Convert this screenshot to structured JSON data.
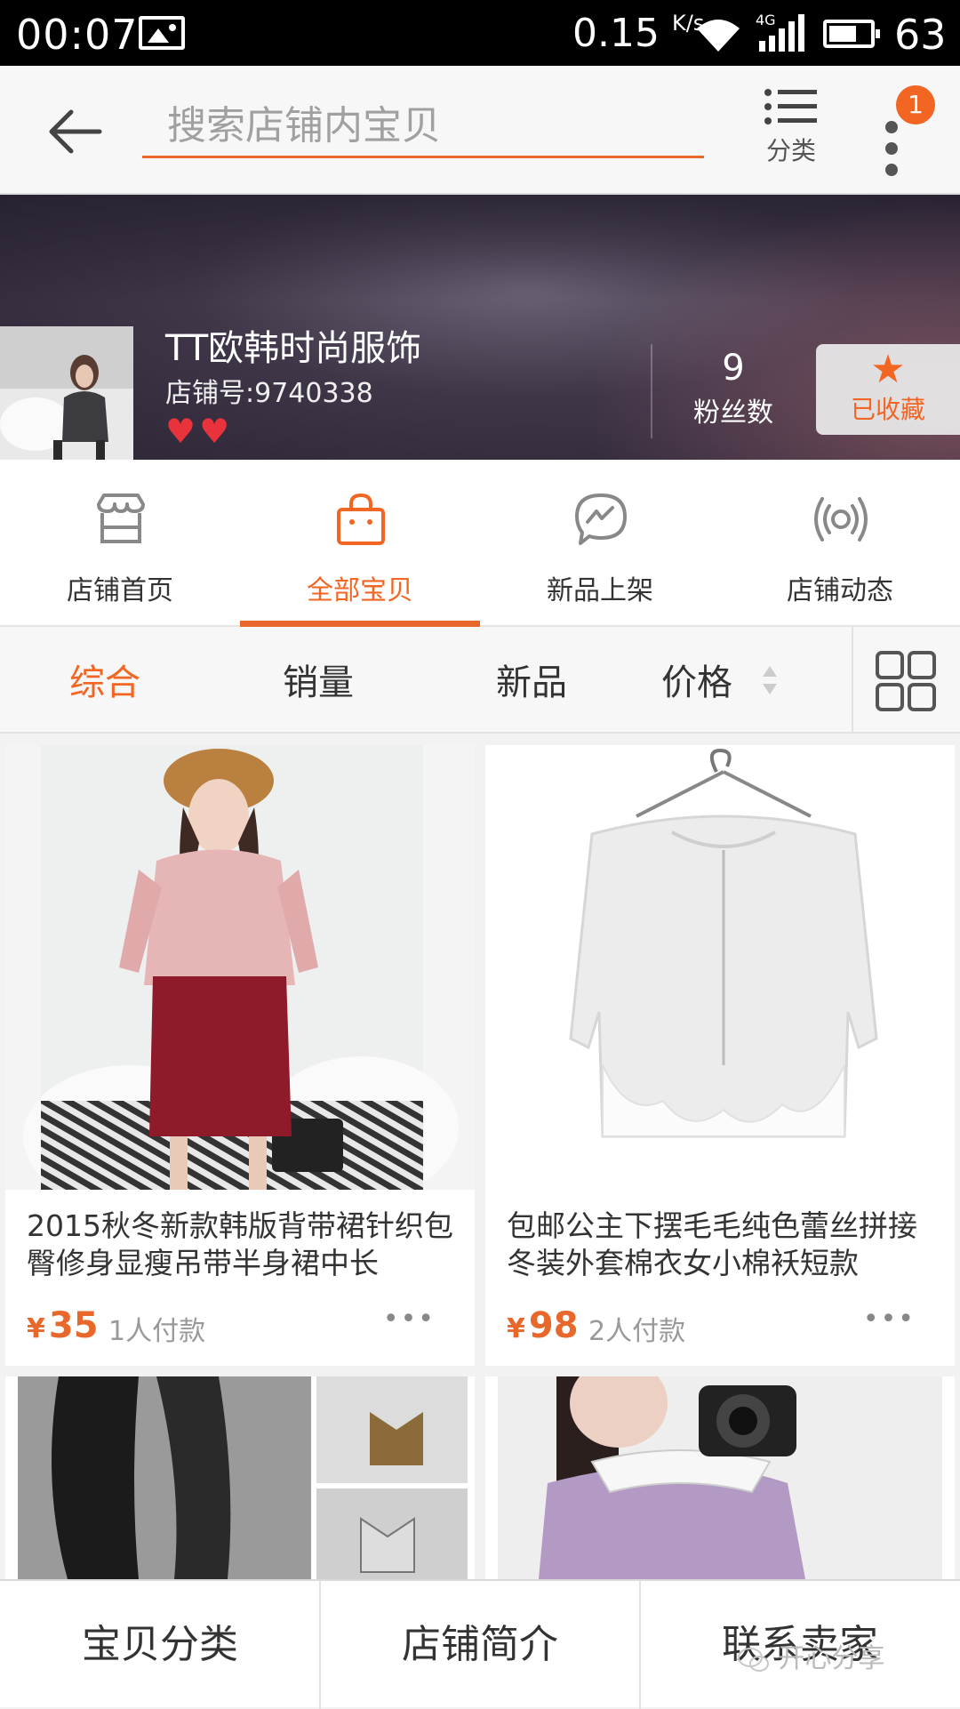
{
  "status_bar": {
    "time": "00:07",
    "speed": "0.15",
    "speed_unit": "K/s",
    "network": "4G",
    "battery": "63"
  },
  "top_bar": {
    "search_placeholder": "搜索店铺内宝贝",
    "category_label": "分类",
    "badge_count": "1"
  },
  "shop": {
    "name": "TT欧韩时尚服饰",
    "id_text": "店铺号:9740338",
    "rating_hearts": 2,
    "fans_count": "9",
    "fans_label": "粉丝数",
    "favorite_label": "已收藏"
  },
  "nav_tabs": [
    {
      "label": "店铺首页",
      "icon": "store-icon",
      "active": false
    },
    {
      "label": "全部宝贝",
      "icon": "shopping-bag-icon",
      "active": true
    },
    {
      "label": "新品上架",
      "icon": "new-arrival-icon",
      "active": false
    },
    {
      "label": "店铺动态",
      "icon": "broadcast-icon",
      "active": false
    }
  ],
  "sort_bar": {
    "items": [
      "综合",
      "销量",
      "新品",
      "价格"
    ],
    "active_index": 0
  },
  "products": [
    {
      "title": "2015秋冬新款韩版背带裙针织包臀修身显瘦吊带半身裙中长",
      "currency": "¥",
      "price": "35",
      "sales": "1人付款"
    },
    {
      "title": "包邮公主下摆毛毛纯色蕾丝拼接冬装外套棉衣女小棉袄短款",
      "currency": "¥",
      "price": "98",
      "sales": "2人付款"
    }
  ],
  "bottom_bar": {
    "items": [
      "宝贝分类",
      "店铺简介",
      "联系卖家"
    ]
  },
  "watermark": "开心分享",
  "colors": {
    "accent": "#e8672a",
    "heart": "#e8323c"
  }
}
